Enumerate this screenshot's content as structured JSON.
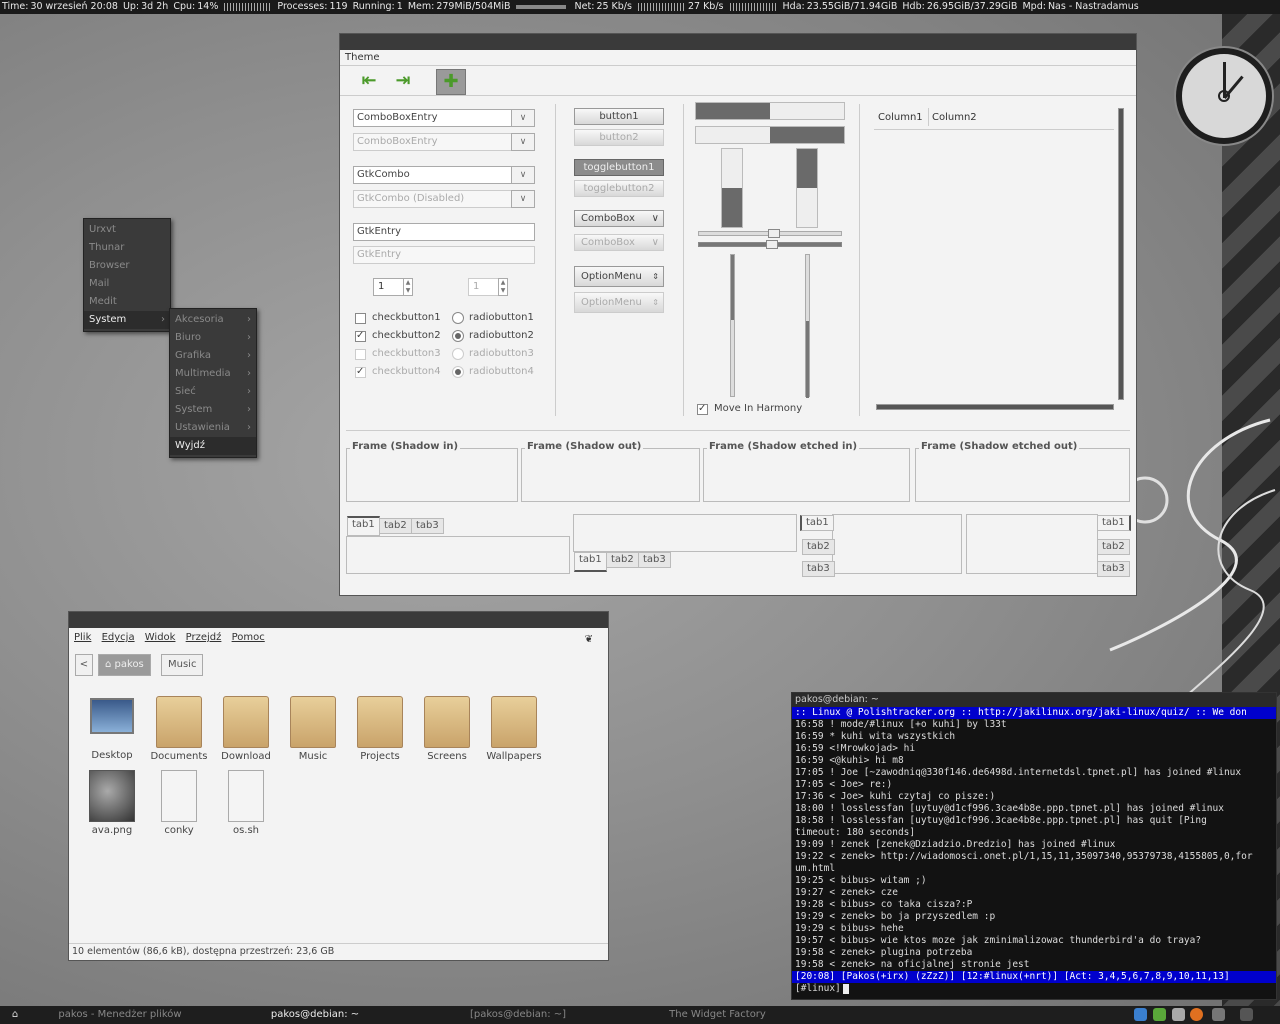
{
  "conky": {
    "time_label": "Time:",
    "time": "30 wrzesień 20:08",
    "uptime_label": "Up:",
    "uptime": "3d 2h",
    "cpu_label": "Cpu:",
    "cpu": "14%",
    "processes_label": "Processes:",
    "processes": "119",
    "running_label": "Running:",
    "running": "1",
    "mem_label": "Mem:",
    "mem": "279MiB/504MiB",
    "net_label": "Net:",
    "net_down": "25 Kb/s",
    "net_up": "27 Kb/s",
    "hda_label": "Hda:",
    "hda": "23.55GiB/71.94GiB",
    "hdb_label": "Hdb:",
    "hdb": "26.95GiB/37.29GiB",
    "mpd_label": "Mpd:",
    "mpd": "Nas - Nastradamus"
  },
  "menu": {
    "items": [
      "Urxvt",
      "Thunar",
      "Browser",
      "Mail",
      "Medit",
      "System"
    ],
    "submenu": [
      "Akcesoria",
      "Biuro",
      "Grafika",
      "Multimedia",
      "Sieć",
      "System",
      "Ustawienia",
      "Wyjdź"
    ]
  },
  "widget_factory": {
    "menu_label": "Theme",
    "combo1": "ComboBoxEntry",
    "combo2": "ComboBoxEntry",
    "gtkcombo1": "GtkCombo",
    "gtkcombo2": "GtkCombo (Disabled)",
    "entry1": "GtkEntry",
    "entry2": "GtkEntry",
    "spin1": "1",
    "spin2": "1",
    "checks": [
      "checkbutton1",
      "checkbutton2",
      "checkbutton3",
      "checkbutton4"
    ],
    "radios": [
      "radiobutton1",
      "radiobutton2",
      "radiobutton3",
      "radiobutton4"
    ],
    "button1": "button1",
    "button2": "button2",
    "toggle1": "togglebutton1",
    "toggle2": "togglebutton2",
    "combobox1": "ComboBox",
    "combobox2": "ComboBox",
    "optionmenu1": "OptionMenu",
    "optionmenu2": "OptionMenu",
    "harmony": "Move In Harmony",
    "col1": "Column1",
    "col2": "Column2",
    "frame1": "Frame (Shadow in)",
    "frame2": "Frame (Shadow out)",
    "frame3": "Frame (Shadow etched in)",
    "frame4": "Frame (Shadow etched out)",
    "tabs": [
      "tab1",
      "tab2",
      "tab3"
    ]
  },
  "file_manager": {
    "menu": [
      "Plik",
      "Edycja",
      "Widok",
      "Przejdź",
      "Pomoc"
    ],
    "crumbs": [
      "pakos",
      "Music"
    ],
    "items": [
      "Desktop",
      "Documents",
      "Download",
      "Music",
      "Projects",
      "Screens",
      "Wallpapers",
      "ava.png",
      "conky",
      "os.sh"
    ],
    "status": "10 elementów (86,6 kB), dostępna przestrzeń: 23,6 GB"
  },
  "terminal": {
    "title": "pakos@debian: ~",
    "topic": " :: Linux @ Polishtracker.org :: http://jakilinux.org/jaki-linux/quiz/ :: We don",
    "lines": [
      "16:58  !  mode/#linux [+o kuhi] by l33t",
      "16:59  * kuhi wita wszystkich",
      "16:59 <!Mrowkojad> hi",
      "16:59 <@kuhi> hi m8",
      "17:05  !  Joe [~zawodniq@330f146.de6498d.internetdsl.tpnet.pl] has joined #linux",
      "17:05 < Joe> re:)",
      "17:36 < Joe> kuhi czytaj co pisze:)",
      "18:00  !  losslessfan [uytuy@d1cf996.3cae4b8e.ppp.tpnet.pl] has joined #linux",
      "18:58  !  losslessfan [uytuy@d1cf996.3cae4b8e.ppp.tpnet.pl] has quit [Ping",
      "           timeout: 180 seconds]",
      "19:09  !  zenek [zenek@Dziadzio.Dredzio] has joined #linux",
      "19:22 < zenek> http://wiadomosci.onet.pl/1,15,11,35097340,95379738,4155805,0,for",
      "um.html",
      "19:25 < bibus> witam ;)",
      "19:27 < zenek> cze",
      "19:28 < bibus> co taka cisza?:P",
      "19:29 < zenek> bo ja przyszedlem :p",
      "19:29 < bibus> hehe",
      "19:57 < bibus> wie ktos moze jak zminimalizowac thunderbird'a do traya?",
      "19:58 < zenek> plugina potrzeba",
      "19:58 < zenek> na oficjalnej stronie jest"
    ],
    "status": " [20:08] [Pakos(+irx) (zZzZ)] [12:#linux(+nrt)] [Act: 3,4,5,6,7,8,9,10,11,13]",
    "input": "[#linux]"
  },
  "taskbar": {
    "tasks": [
      "pakos - Menedżer plików",
      "pakos@debian: ~",
      "[pakos@debian: ~]",
      "The Widget Factory"
    ]
  },
  "colors": {
    "accent_green": "#4b9a2a",
    "term_blue": "#0000cc",
    "term_cyan": "#3fa7c7"
  }
}
